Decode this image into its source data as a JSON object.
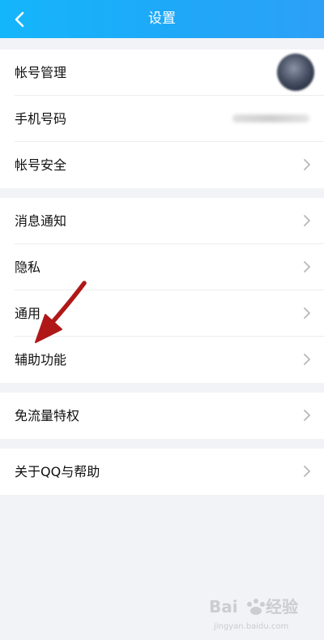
{
  "header": {
    "title": "设置",
    "back_icon": "chevron-left-icon",
    "background": "#1fa8f8"
  },
  "groups": [
    {
      "items": [
        {
          "label": "帐号管理",
          "trailing": "avatar"
        },
        {
          "label": "手机号码",
          "trailing": "blurred-phone-number"
        },
        {
          "label": "帐号安全",
          "trailing": "chevron-right-icon"
        }
      ]
    },
    {
      "items": [
        {
          "label": "消息通知",
          "trailing": "chevron-right-icon"
        },
        {
          "label": "隐私",
          "trailing": "chevron-right-icon"
        },
        {
          "label": "通用",
          "trailing": "chevron-right-icon"
        },
        {
          "label": "辅助功能",
          "trailing": "chevron-right-icon"
        }
      ]
    },
    {
      "items": [
        {
          "label": "免流量特权",
          "trailing": "chevron-right-icon"
        }
      ]
    },
    {
      "items": [
        {
          "label": "关于QQ与帮助",
          "trailing": "chevron-right-icon"
        }
      ]
    }
  ],
  "annotation": {
    "type": "red-arrow",
    "target": "辅助功能",
    "color": "#b01818"
  },
  "watermark": {
    "text": "Baidu经验",
    "sub": "jingyan.baidu.com"
  },
  "colors": {
    "page_background": "#f1f3f6",
    "row_background": "#ffffff",
    "chevron": "#b8b8b8"
  }
}
